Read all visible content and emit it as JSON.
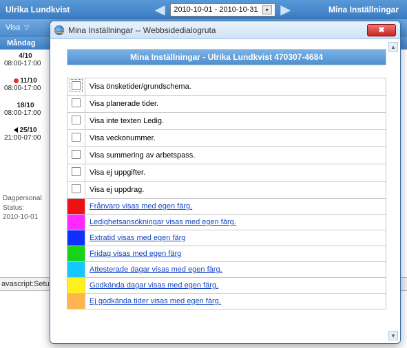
{
  "topbar": {
    "user_name": "Ulrika Lundkvist",
    "date_range": "2010-10-01 - 2010-10-31",
    "settings_label": "Mina Inställningar"
  },
  "subbar": {
    "visa_label": "Visa"
  },
  "week_header": "Måndag",
  "days": [
    {
      "date": "4/10",
      "time": "08:00-17:00",
      "marker": ""
    },
    {
      "date": "11/10",
      "time": "08:00-17:00",
      "marker": "red"
    },
    {
      "date": "18/10",
      "time": "08:00-17:00",
      "marker": ""
    },
    {
      "date": "25/10",
      "time": "21:00-07:00",
      "marker": "left"
    }
  ],
  "footer_lines": [
    "Dagpersonal",
    "Status:",
    "2010-10-01"
  ],
  "status_bar": "avascript:Setup",
  "dialog": {
    "window_title": "Mina Inställningar -- Webbsidedialogruta",
    "panel_title": "Mina Inställningar - Ulrika Lundkvist 470307-4684",
    "checkbox_rows": [
      "Visa önsketider/grundschema.",
      "Visa planerade tider.",
      "Visa inte texten Ledig.",
      "Visa veckonummer.",
      "Visa summering av arbetspass.",
      "Visa ej uppgifter.",
      "Visa ej uppdrag."
    ],
    "color_rows": [
      {
        "color": "#e11",
        "label": "Frånvaro visas med egen färg."
      },
      {
        "color": "#ff29ff",
        "label": "Ledighetsansökningar visas med egen färg."
      },
      {
        "color": "#1030ff",
        "label": "Extratid visas med egen färg"
      },
      {
        "color": "#17d41a",
        "label": "Fridag visas med egen färg"
      },
      {
        "color": "#17c7ff",
        "label": "Attesterade dagar visas med egen färg."
      },
      {
        "color": "#ffef1f",
        "label": "Godkända dagar visas med egen färg."
      },
      {
        "color": "#ffb54d",
        "label": "Ej godkända tider visas med egen färg."
      }
    ]
  }
}
